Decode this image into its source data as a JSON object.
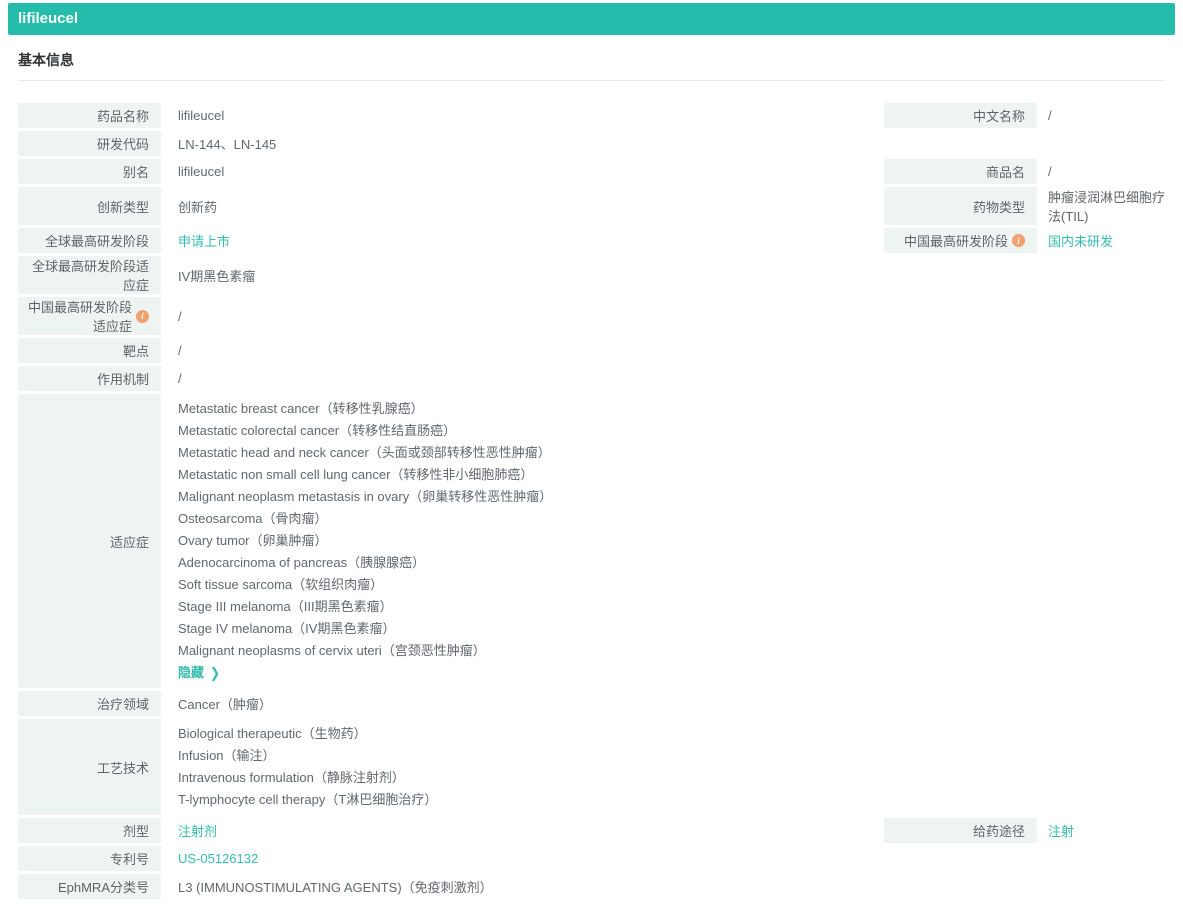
{
  "accent_color": "#26bcab",
  "link_color": "#36bcab",
  "label_bg_color": "#eef4f2",
  "header": {
    "title": "lifileucel"
  },
  "section": {
    "title": "基本信息"
  },
  "fields": {
    "drug_name": {
      "label": "药品名称",
      "value": "lifileucel"
    },
    "cn_name": {
      "label": "中文名称",
      "value": "/"
    },
    "rd_code": {
      "label": "研发代码",
      "value": "LN-144、LN-145"
    },
    "alias": {
      "label": "别名",
      "value": "lifileucel"
    },
    "trade_name": {
      "label": "商品名",
      "value": "/"
    },
    "innovation_type": {
      "label": "创新类型",
      "value": "创新药"
    },
    "drug_type": {
      "label": "药物类型",
      "value": "肿瘤浸润淋巴细胞疗法(TIL)"
    },
    "global_stage": {
      "label": "全球最高研发阶段",
      "value": "申请上市"
    },
    "china_stage": {
      "label": "中国最高研发阶段",
      "value": "国内未研发",
      "info_icon": "info-icon"
    },
    "global_stage_indication": {
      "label": "全球最高研发阶段适应症",
      "value": "IV期黑色素瘤"
    },
    "china_stage_indication": {
      "label": "中国最高研发阶段适应症",
      "value": "/",
      "info_icon": "info-icon"
    },
    "target": {
      "label": "靶点",
      "value": "/"
    },
    "moa": {
      "label": "作用机制",
      "value": "/"
    },
    "indications": {
      "label": "适应症",
      "items": [
        "Metastatic breast cancer（转移性乳腺癌）",
        "Metastatic colorectal cancer（转移性结直肠癌）",
        "Metastatic head and neck cancer（头面或颈部转移性恶性肿瘤）",
        "Metastatic non small cell lung cancer（转移性非小细胞肺癌）",
        "Malignant neoplasm metastasis in ovary（卵巢转移性恶性肿瘤）",
        "Osteosarcoma（骨肉瘤）",
        "Ovary tumor（卵巢肿瘤）",
        "Adenocarcinoma of pancreas（胰腺腺癌）",
        "Soft tissue sarcoma（软组织肉瘤）",
        "Stage III melanoma（III期黑色素瘤）",
        "Stage IV melanoma（IV期黑色素瘤）",
        "Malignant neoplasms of cervix uteri（宫颈恶性肿瘤）"
      ],
      "hide_label": "隐藏",
      "hide_chevron": "❯"
    },
    "therapy_area": {
      "label": "治疗领域",
      "value": "Cancer（肿瘤）"
    },
    "technology": {
      "label": "工艺技术",
      "items": [
        "Biological therapeutic（生物药）",
        "Infusion（输注）",
        "Intravenous formulation（静脉注射剂）",
        "T-lymphocyte cell therapy（T淋巴细胞治疗）"
      ]
    },
    "dosage_form": {
      "label": "剂型",
      "value": "注射剂"
    },
    "route": {
      "label": "给药途径",
      "value": "注射"
    },
    "patent": {
      "label": "专利号",
      "value": "US-05126132"
    },
    "ephmra": {
      "label": "EphMRA分类号",
      "value": "L3 (IMMUNOSTIMULATING AGENTS)（免疫刺激剂）"
    }
  }
}
